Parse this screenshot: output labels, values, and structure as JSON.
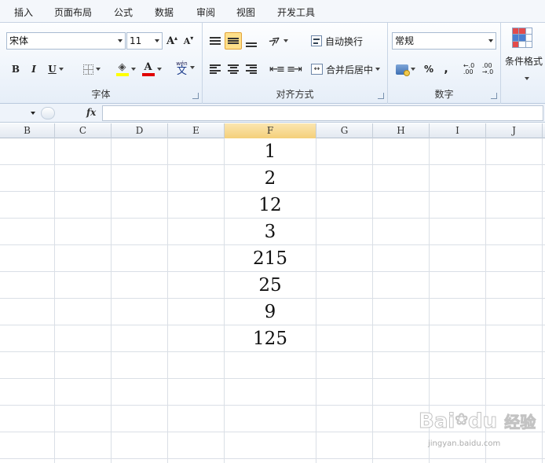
{
  "tabs": [
    "插入",
    "页面布局",
    "公式",
    "数据",
    "审阅",
    "视图",
    "开发工具"
  ],
  "font": {
    "name": "宋体",
    "size": "11",
    "grow_label": "A",
    "shrink_label": "A",
    "bold": "B",
    "italic": "I",
    "underline": "U",
    "font_color_label": "A",
    "phonetic_label": "文",
    "phonetic_top": "wén",
    "group_label": "字体"
  },
  "alignment": {
    "wrap_label": "自动换行",
    "merge_label": "合并后居中",
    "group_label": "对齐方式"
  },
  "number": {
    "format": "常规",
    "percent": "%",
    "comma": ",",
    "group_label": "数字"
  },
  "styles": {
    "conditional_label": "条件格式"
  },
  "formula_bar": {
    "fx": "fx"
  },
  "columns": [
    "B",
    "C",
    "D",
    "E",
    "F",
    "G",
    "H",
    "I",
    "J"
  ],
  "cells_f": [
    "1",
    "2",
    "12",
    "3",
    "215",
    "25",
    "9",
    "125"
  ],
  "watermark": {
    "brand": "Bai",
    "brand2": "du",
    "jingyan": "经验",
    "url": "jingyan.baidu.com"
  },
  "colors": {
    "highlight": "#ffe08a",
    "fill_color": "#ffff00",
    "font_color": "#e00000",
    "selected_col": "#f4cf7a"
  }
}
